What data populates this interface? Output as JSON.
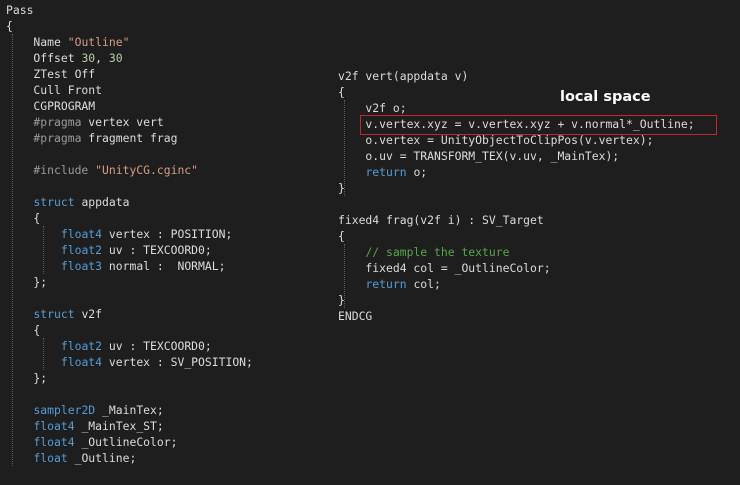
{
  "left_code": [
    [
      {
        "t": "Pass"
      }
    ],
    [
      {
        "t": "{"
      }
    ],
    [
      {
        "t": "    Name "
      },
      {
        "t": "\"Outline\"",
        "c": "str"
      }
    ],
    [
      {
        "t": "    Offset "
      },
      {
        "t": "30",
        "c": "num"
      },
      {
        "t": ", "
      },
      {
        "t": "30",
        "c": "num"
      }
    ],
    [
      {
        "t": "    ZTest Off"
      }
    ],
    [
      {
        "t": "    Cull Front"
      }
    ],
    [
      {
        "t": "    CGPROGRAM"
      }
    ],
    [
      {
        "t": "    #pragma ",
        "c": "pp"
      },
      {
        "t": "vertex vert"
      }
    ],
    [
      {
        "t": "    #pragma ",
        "c": "pp"
      },
      {
        "t": "fragment frag"
      }
    ],
    [
      {
        "t": ""
      }
    ],
    [
      {
        "t": "    #include ",
        "c": "pp"
      },
      {
        "t": "\"UnityCG.cginc\"",
        "c": "str"
      }
    ],
    [
      {
        "t": ""
      }
    ],
    [
      {
        "t": "    "
      },
      {
        "t": "struct",
        "c": "kw"
      },
      {
        "t": " appdata"
      }
    ],
    [
      {
        "t": "    {"
      }
    ],
    [
      {
        "t": "        "
      },
      {
        "t": "float4",
        "c": "kw"
      },
      {
        "t": " vertex : POSITION;"
      }
    ],
    [
      {
        "t": "        "
      },
      {
        "t": "float2",
        "c": "kw"
      },
      {
        "t": " uv : TEXCOORD0;"
      }
    ],
    [
      {
        "t": "        "
      },
      {
        "t": "float3",
        "c": "kw"
      },
      {
        "t": " normal :  NORMAL;"
      }
    ],
    [
      {
        "t": "    };"
      }
    ],
    [
      {
        "t": ""
      }
    ],
    [
      {
        "t": "    "
      },
      {
        "t": "struct",
        "c": "kw"
      },
      {
        "t": " v2f"
      }
    ],
    [
      {
        "t": "    {"
      }
    ],
    [
      {
        "t": "        "
      },
      {
        "t": "float2",
        "c": "kw"
      },
      {
        "t": " uv : TEXCOORD0;"
      }
    ],
    [
      {
        "t": "        "
      },
      {
        "t": "float4",
        "c": "kw"
      },
      {
        "t": " vertex : SV_POSITION;"
      }
    ],
    [
      {
        "t": "    };"
      }
    ],
    [
      {
        "t": ""
      }
    ],
    [
      {
        "t": "    "
      },
      {
        "t": "sampler2D",
        "c": "kw"
      },
      {
        "t": " _MainTex;"
      }
    ],
    [
      {
        "t": "    "
      },
      {
        "t": "float4",
        "c": "kw"
      },
      {
        "t": " _MainTex_ST;"
      }
    ],
    [
      {
        "t": "    "
      },
      {
        "t": "float4",
        "c": "kw"
      },
      {
        "t": " _OutlineColor;"
      }
    ],
    [
      {
        "t": "    "
      },
      {
        "t": "float",
        "c": "kw"
      },
      {
        "t": " _Outline;"
      }
    ]
  ],
  "right_code": [
    [
      {
        "t": "v2f vert(appdata v)"
      }
    ],
    [
      {
        "t": "{"
      }
    ],
    [
      {
        "t": "    v2f o;"
      }
    ],
    [
      {
        "t": "    v.vertex.xyz = v.vertex.xyz + v.normal*_Outline;"
      }
    ],
    [
      {
        "t": "    o.vertex = UnityObjectToClipPos(v.vertex);"
      }
    ],
    [
      {
        "t": "    o.uv = TRANSFORM_TEX(v.uv, _MainTex);"
      }
    ],
    [
      {
        "t": "    "
      },
      {
        "t": "return",
        "c": "kw"
      },
      {
        "t": " o;"
      }
    ],
    [
      {
        "t": "}"
      }
    ],
    [
      {
        "t": ""
      }
    ],
    [
      {
        "t": "fixed4 frag(v2f i) : SV_Target"
      }
    ],
    [
      {
        "t": "{"
      }
    ],
    [
      {
        "t": "    "
      },
      {
        "t": "// sample the texture",
        "c": "cm"
      }
    ],
    [
      {
        "t": "    fixed4 col = _OutlineColor;"
      }
    ],
    [
      {
        "t": "    "
      },
      {
        "t": "return",
        "c": "kw"
      },
      {
        "t": " col;"
      }
    ],
    [
      {
        "t": "}"
      }
    ],
    [
      {
        "t": "ENDCG"
      }
    ]
  ],
  "annotation": {
    "text": "local space"
  },
  "colors": {
    "background": "#1e1e1e",
    "text": "#dcdcdc",
    "keyword": "#569cd6",
    "string": "#d69d85",
    "number": "#b5cea8",
    "preprocessor": "#9b9b9b",
    "comment": "#57a64a",
    "highlight_border": "#c4262e",
    "annotation": "#ffffff"
  }
}
